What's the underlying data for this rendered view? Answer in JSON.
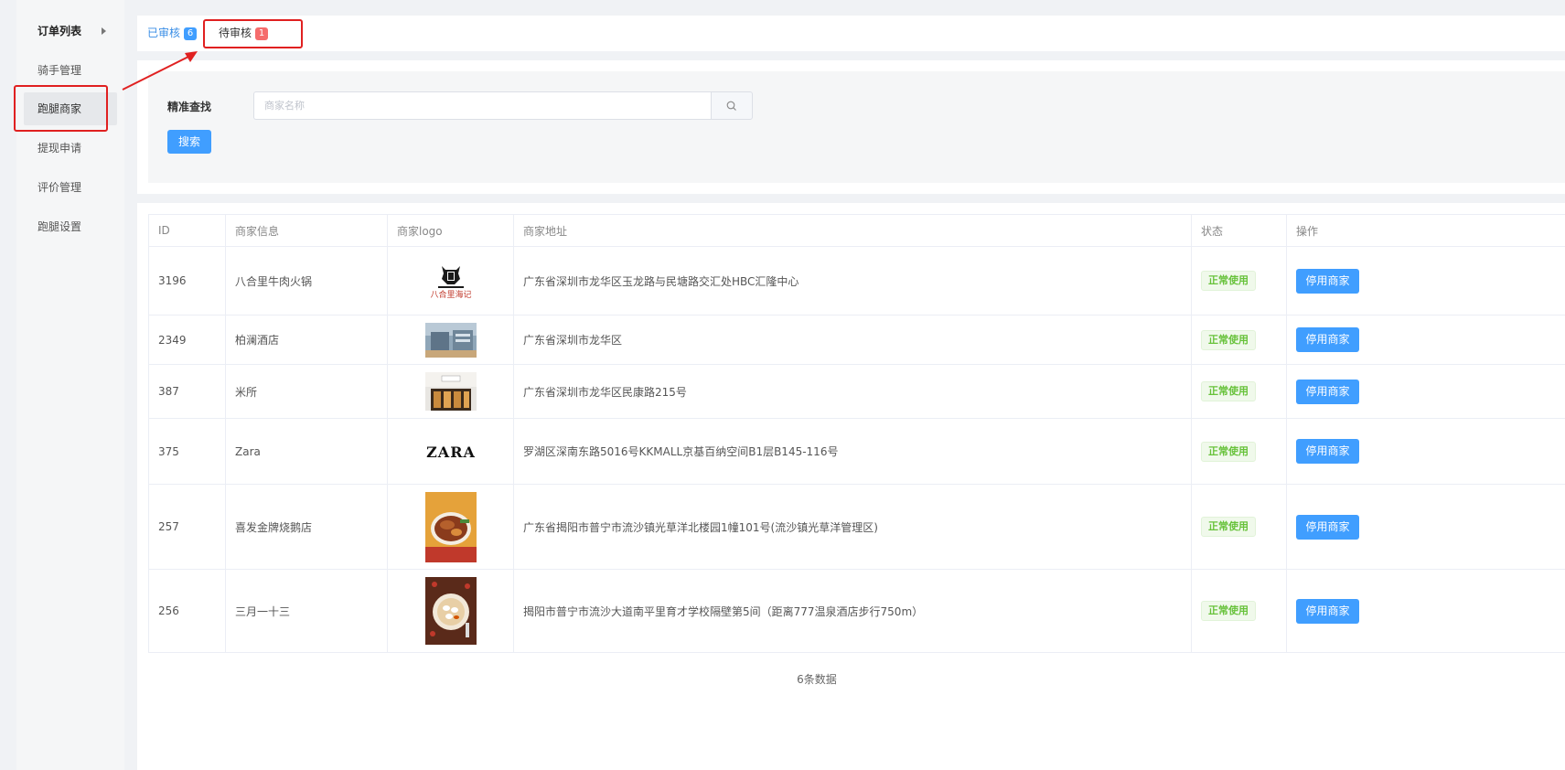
{
  "sidebar": {
    "items": [
      {
        "label": "订单列表"
      },
      {
        "label": "骑手管理"
      },
      {
        "label": "跑腿商家"
      },
      {
        "label": "提现申请"
      },
      {
        "label": "评价管理"
      },
      {
        "label": "跑腿设置"
      }
    ]
  },
  "tabs": [
    {
      "label": "已审核",
      "count": "6"
    },
    {
      "label": "待审核",
      "count": "1"
    }
  ],
  "filter": {
    "label": "精准查找",
    "placeholder": "商家名称",
    "value": "",
    "search_button": "搜索"
  },
  "table": {
    "columns": [
      "ID",
      "商家信息",
      "商家logo",
      "商家地址",
      "状态",
      "操作"
    ],
    "rows": [
      {
        "id": "3196",
        "name": "八合里牛肉火锅",
        "logo": "八合里海记",
        "address": "广东省深圳市龙华区玉龙路与民塘路交汇处HBC汇隆中心",
        "status": "正常使用",
        "action": "停用商家"
      },
      {
        "id": "2349",
        "name": "柏澜酒店",
        "logo": "hotel-photo",
        "address": "广东省深圳市龙华区",
        "status": "正常使用",
        "action": "停用商家"
      },
      {
        "id": "387",
        "name": "米所",
        "logo": "storefront-photo",
        "address": "广东省深圳市龙华区民康路215号",
        "status": "正常使用",
        "action": "停用商家"
      },
      {
        "id": "375",
        "name": "Zara",
        "logo": "ZARA",
        "address": "罗湖区深南东路5016号KKMALL京基百纳空间B1层B145-116号",
        "status": "正常使用",
        "action": "停用商家"
      },
      {
        "id": "257",
        "name": "喜发金牌烧鹅店",
        "logo": "noodle-bowl-photo",
        "address": "广东省揭阳市普宁市流沙镇光草洋北楼园1幢101号(流沙镇光草洋管理区)",
        "status": "正常使用",
        "action": "停用商家"
      },
      {
        "id": "256",
        "name": "三月一十三",
        "logo": "dumpling-plate-photo",
        "address": "揭阳市普宁市流沙大道南平里育才学校隔壁第5间（距离777温泉酒店步行750m）",
        "status": "正常使用",
        "action": "停用商家"
      }
    ],
    "footer": "6条数据"
  },
  "colors": {
    "primary": "#409eff",
    "success": "#67c23a",
    "danger": "#f56c6c",
    "annotation": "#e02020"
  }
}
